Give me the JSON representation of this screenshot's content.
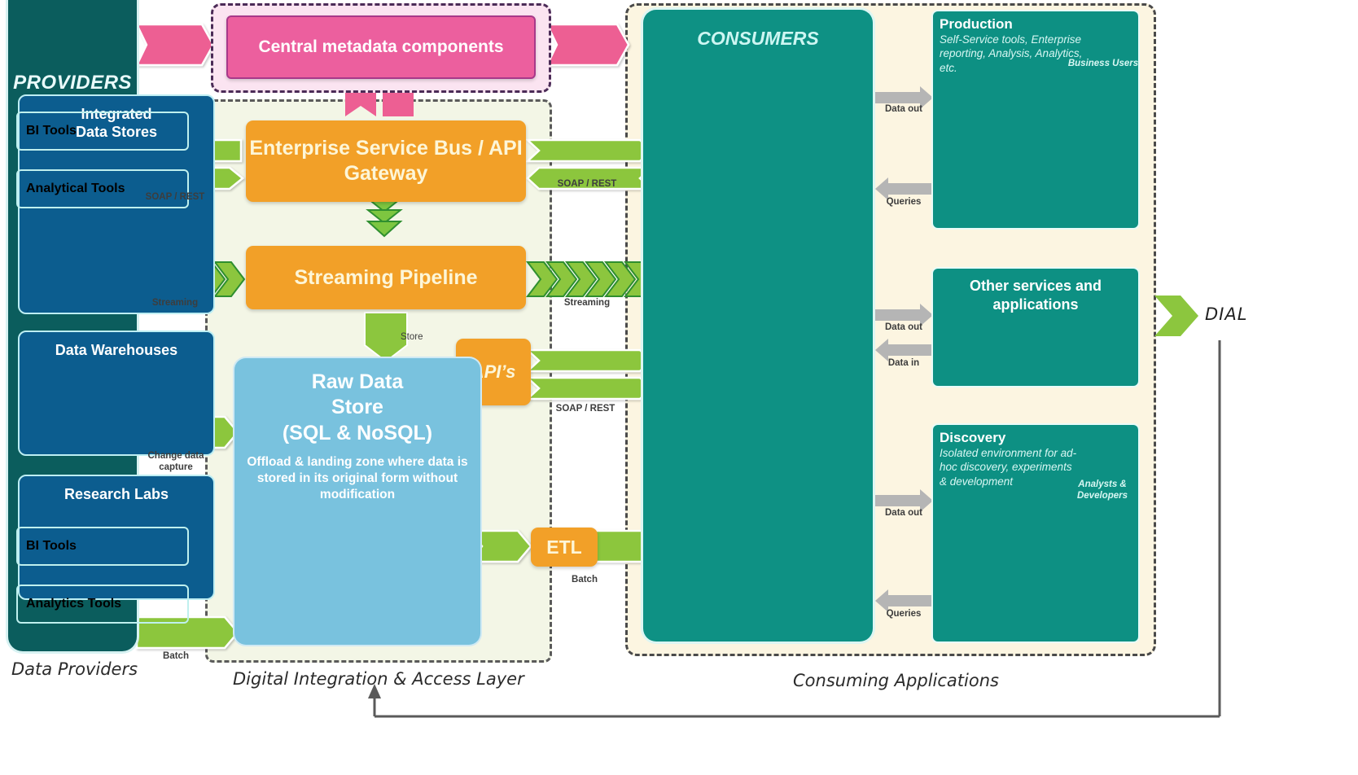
{
  "providers": {
    "title": "PROVIDERS",
    "bottom_label": "Data Providers",
    "icons": [
      "cloud-icon",
      "web-click-icon",
      "network-hub-icon",
      "database-icon",
      "database-icon",
      "database-icon"
    ]
  },
  "metadata": {
    "title": "Central metadata components"
  },
  "dial": {
    "bottom_label": "Digital Integration & Access Layer",
    "esb": "Enterprise Service Bus / API Gateway",
    "streaming_pipeline": "Streaming Pipeline",
    "apis": "API’s",
    "etl": "ETL",
    "raw_store_title": "Raw Data Store (SQL & NoSQL)",
    "raw_store_line1": "Raw Data",
    "raw_store_line2": "Store",
    "raw_store_line3": "(SQL & NoSQL)",
    "raw_store_desc": "Offload & landing zone where data is stored in its original form without modification",
    "store_arrow_label": "Store"
  },
  "left_connectors": [
    {
      "label": "SOAP / REST",
      "name": "soap-rest-left"
    },
    {
      "label": "Streaming",
      "name": "streaming-left"
    },
    {
      "label": "Change data capture",
      "name": "change-data-capture"
    },
    {
      "label": "Batch",
      "name": "batch-left"
    }
  ],
  "right_connectors": [
    {
      "label": "SOAP / REST",
      "name": "soap-rest-right-top"
    },
    {
      "label": "Streaming",
      "name": "streaming-right"
    },
    {
      "label": "SOAP / REST",
      "name": "soap-rest-right-api"
    },
    {
      "label": "Batch",
      "name": "batch-right"
    }
  ],
  "consumers": {
    "title": "CONSUMERS",
    "bottom_label": "Consuming Applications",
    "cards": [
      {
        "title": "Integrated Data Stores",
        "line1": "Integrated",
        "line2": "Data Stores",
        "db_count": 2
      },
      {
        "title": "Data Warehouses",
        "line1": "Data Warehouses",
        "line2": "",
        "db_count": 2
      },
      {
        "title": "Research Labs",
        "line1": "Research Labs",
        "line2": "",
        "db_count": 1
      }
    ]
  },
  "right_panels": [
    {
      "name": "production",
      "title": "Production",
      "subtitle": "Self-Service tools, Enterprise reporting, Analysis, Analytics, etc.",
      "persona": "Business Users",
      "persona_icon": "user-icon",
      "tools": [
        {
          "label": "BI Tools",
          "icon": "gear-icon"
        },
        {
          "label": "Analytical Tools",
          "icon": "gear-icon"
        }
      ],
      "arrows": [
        {
          "label": "Data out",
          "dir": "right"
        },
        {
          "label": "Queries",
          "dir": "left"
        }
      ]
    },
    {
      "name": "other-services",
      "title": "Other services and applications",
      "subtitle": "",
      "persona": "",
      "persona_icon": "network-hub-icon",
      "tools": [],
      "arrows": [
        {
          "label": "Data out",
          "dir": "right"
        },
        {
          "label": "Data in",
          "dir": "left"
        }
      ]
    },
    {
      "name": "discovery",
      "title": "Discovery",
      "subtitle": "Isolated environment for ad-hoc discovery, experiments & development",
      "persona": "Analysts & Developers",
      "persona_icon": "user-icon",
      "tools": [
        {
          "label": "BI Tools",
          "icon": "gear-icon"
        },
        {
          "label": "Analytics Tools",
          "icon": "gear-icon"
        }
      ],
      "arrows": [
        {
          "label": "Data out",
          "dir": "right"
        },
        {
          "label": "Queries",
          "dir": "left"
        }
      ]
    }
  ],
  "dial_exit": {
    "label": "DIAL"
  },
  "colors": {
    "providers_bg": "#0b5d5d",
    "consumers_bg": "#0e9184",
    "consumer_card_bg": "#0c5d8f",
    "orange": "#f2a028",
    "green_arrow": "#8cc63e",
    "pink": "#ec5f9e",
    "raw_store_blue": "#79c2de",
    "dial_bg": "#f3f6e6",
    "consumers_zone_bg": "#fcf5e1",
    "gray_arrow": "#b5b5b5"
  }
}
